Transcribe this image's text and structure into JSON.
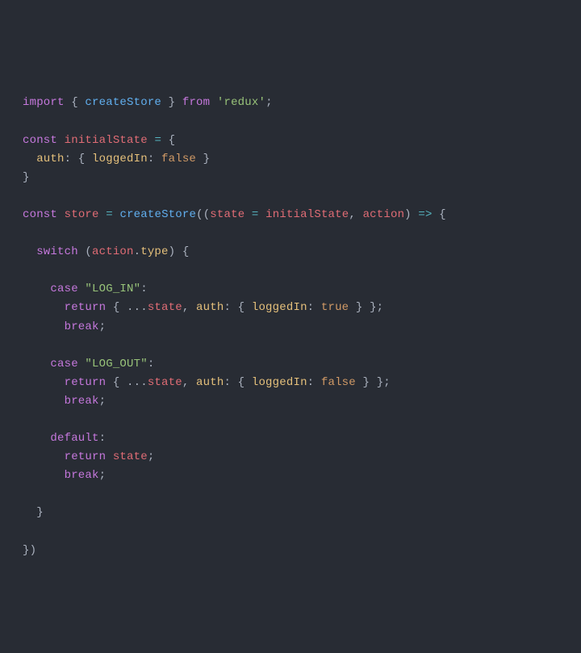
{
  "code": {
    "t1": "import",
    "t2": " { ",
    "t3": "createStore",
    "t4": " } ",
    "t5": "from",
    "t6": " ",
    "t7": "'redux'",
    "t8": ";",
    "t9": "const",
    "t10": " ",
    "t11": "initialState",
    "t12": " ",
    "t13": "=",
    "t14": " {",
    "t15": "  ",
    "t16": "auth",
    "t17": ": { ",
    "t18": "loggedIn",
    "t19": ": ",
    "t20": "false",
    "t21": " }",
    "t22": "}",
    "t23": "const",
    "t24": " ",
    "t25": "store",
    "t26": " ",
    "t27": "=",
    "t28": " ",
    "t29": "createStore",
    "t30": "((",
    "t31": "state",
    "t32": " ",
    "t33": "=",
    "t34": " ",
    "t35": "initialState",
    "t36": ", ",
    "t37": "action",
    "t38": ") ",
    "t39": "=>",
    "t40": " {",
    "t41": "  ",
    "t42": "switch",
    "t43": " (",
    "t44": "action",
    "t45": ".",
    "t46": "type",
    "t47": ") {",
    "t48": "    ",
    "t49": "case",
    "t50": " ",
    "t51": "\"LOG_IN\"",
    "t52": ":",
    "t53": "      ",
    "t54": "return",
    "t55": " { ...",
    "t56": "state",
    "t57": ", ",
    "t58": "auth",
    "t59": ": { ",
    "t60": "loggedIn",
    "t61": ": ",
    "t62": "true",
    "t63": " } };",
    "t64": "      ",
    "t65": "break",
    "t66": ";",
    "t67": "    ",
    "t68": "case",
    "t69": " ",
    "t70": "\"LOG_OUT\"",
    "t71": ":",
    "t72": "      ",
    "t73": "return",
    "t74": " { ...",
    "t75": "state",
    "t76": ", ",
    "t77": "auth",
    "t78": ": { ",
    "t79": "loggedIn",
    "t80": ": ",
    "t81": "false",
    "t82": " } };",
    "t83": "      ",
    "t84": "break",
    "t85": ";",
    "t86": "    ",
    "t87": "default",
    "t88": ":",
    "t89": "      ",
    "t90": "return",
    "t91": " ",
    "t92": "state",
    "t93": ";",
    "t94": "      ",
    "t95": "break",
    "t96": ";",
    "t97": "  }",
    "t98": "})"
  }
}
